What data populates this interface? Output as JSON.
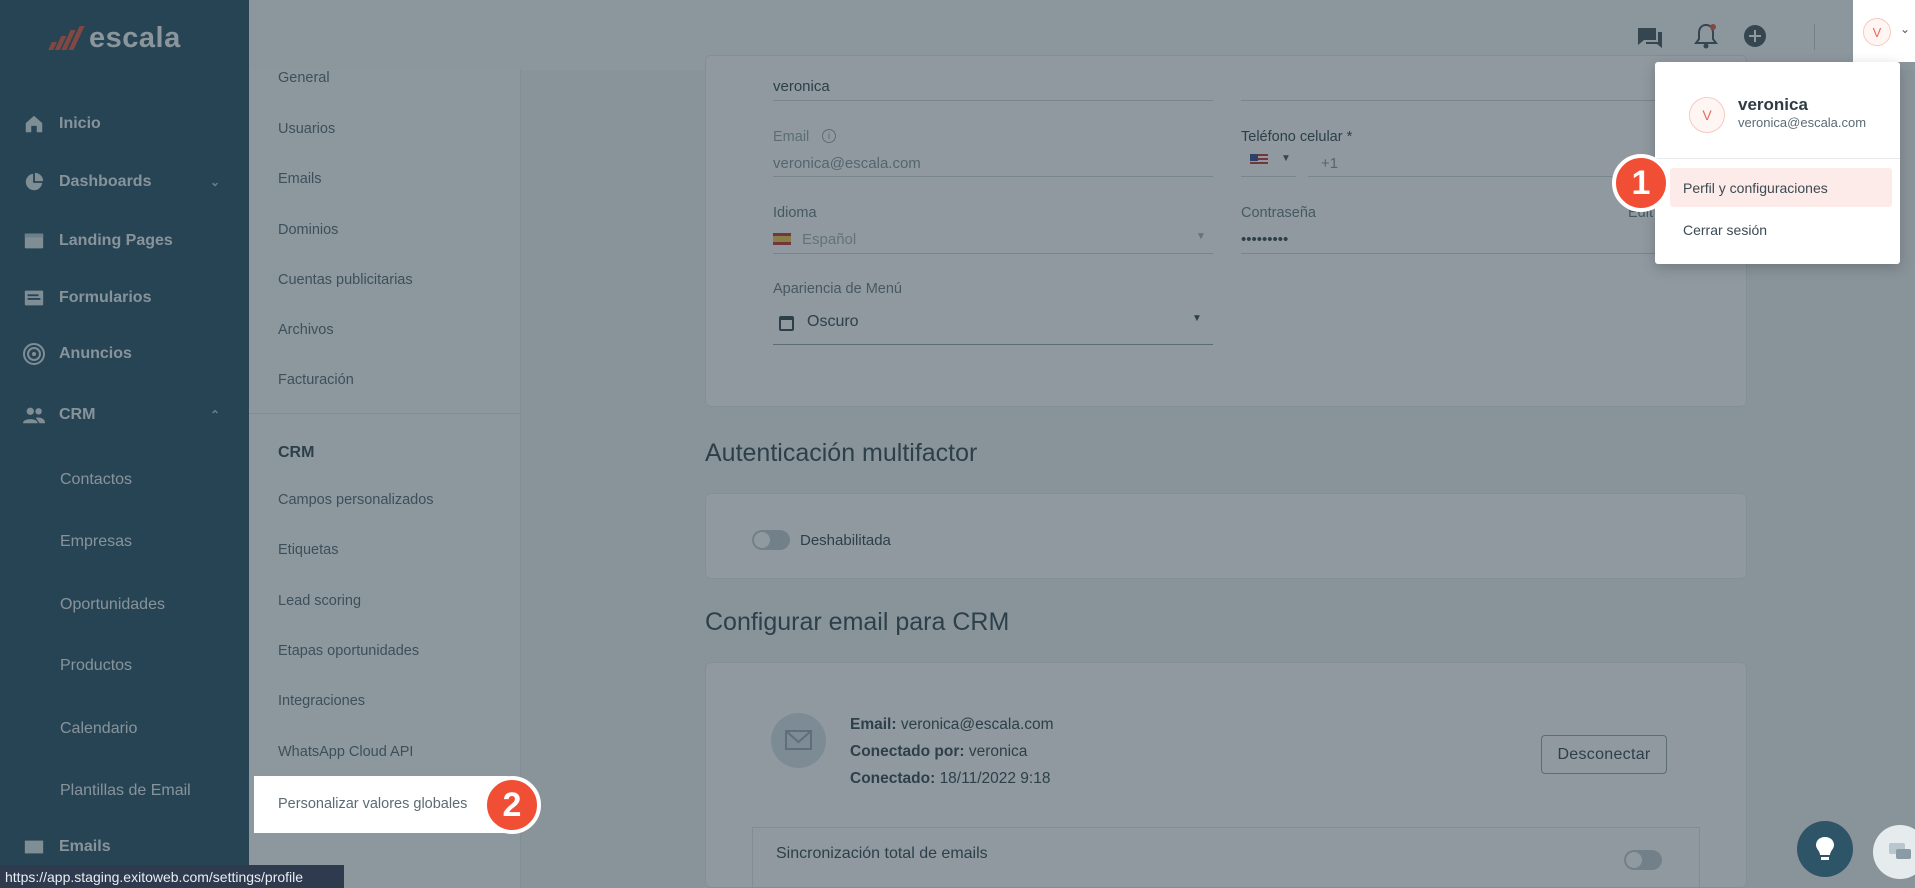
{
  "brand": {
    "name": "escala",
    "accent": "#e05a47",
    "sidebar_bg": "#2e5468"
  },
  "sidebar": {
    "items": [
      {
        "label": "Inicio",
        "icon": "home-icon"
      },
      {
        "label": "Dashboards",
        "icon": "pie-chart-icon",
        "chevron": "⌄"
      },
      {
        "label": "Landing Pages",
        "icon": "landing-page-icon"
      },
      {
        "label": "Formularios",
        "icon": "form-icon"
      },
      {
        "label": "Anuncios",
        "icon": "ads-icon"
      },
      {
        "label": "CRM",
        "icon": "people-icon",
        "chevron": "⌃"
      }
    ],
    "crm_children": [
      "Contactos",
      "Empresas",
      "Oportunidades",
      "Productos",
      "Calendario",
      "Plantillas de Email"
    ],
    "partial_item": "Emails"
  },
  "settings_nav": {
    "general": [
      "General",
      "Usuarios",
      "Emails",
      "Dominios",
      "Cuentas publicitarias",
      "Archivos",
      "Facturación"
    ],
    "crm_heading": "CRM",
    "crm": [
      "Campos personalizados",
      "Etiquetas",
      "Lead scoring",
      "Etapas oportunidades",
      "Integraciones",
      "WhatsApp Cloud API",
      "Personalizar valores globales"
    ]
  },
  "profile_form": {
    "name_value": "veronica",
    "email_label": "Email",
    "email_value": "veronica@escala.com",
    "phone_label": "Teléfono celular *",
    "phone_prefix": "+1",
    "language_label": "Idioma",
    "language_value": "Español",
    "password_label": "Contraseña",
    "password_value": "•••••••••",
    "password_edit": "Edit",
    "menu_label": "Apariencia de Menú",
    "menu_value": "Oscuro"
  },
  "mfa": {
    "title": "Autenticación multifactor",
    "toggle_label": "Deshabilitada"
  },
  "crm_email": {
    "title": "Configurar email para CRM",
    "email_key": "Email:",
    "email_value": "veronica@escala.com",
    "connected_by_key": "Conectado por:",
    "connected_by_value": "veronica",
    "connected_key": "Conectado:",
    "connected_value": "18/11/2022 9:18",
    "disconnect_button": "Desconectar",
    "sync_label": "Sincronización total de emails"
  },
  "user_menu": {
    "avatar_letter": "V",
    "name": "veronica",
    "email": "veronica@escala.com",
    "item_profile": "Perfil y configuraciones",
    "item_logout": "Cerrar sesión"
  },
  "step_badges": [
    "1",
    "2"
  ],
  "status_url": "https://app.staging.exitoweb.com/settings/profile",
  "colors": {
    "badge": "#f04f36",
    "overlay": "rgba(31,52,64,0.5)",
    "fab_dark": "#2e5468"
  }
}
